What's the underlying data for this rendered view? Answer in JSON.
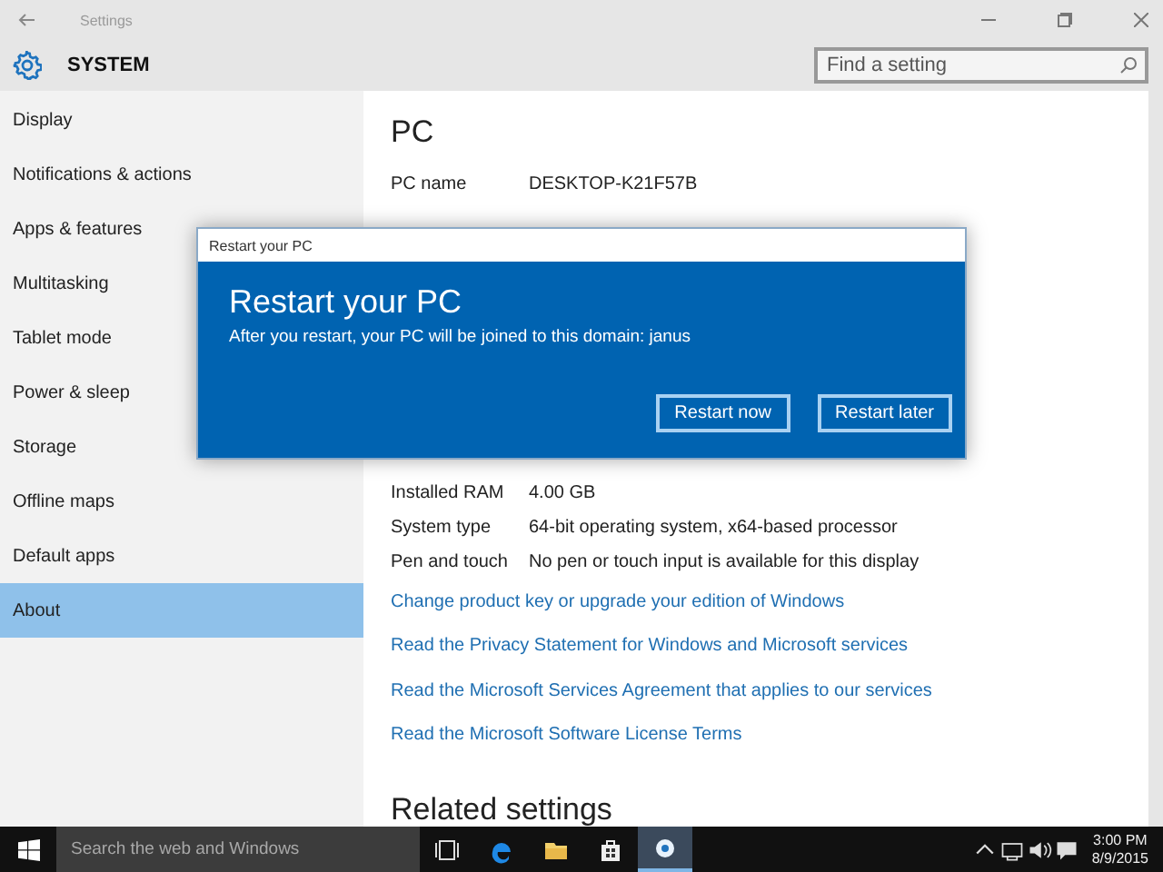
{
  "window": {
    "title": "Settings"
  },
  "header": {
    "title": "SYSTEM",
    "search": {
      "placeholder": "Find a setting"
    }
  },
  "sidebar": {
    "items": [
      {
        "label": "Display",
        "selected": false
      },
      {
        "label": "Notifications & actions",
        "selected": false
      },
      {
        "label": "Apps & features",
        "selected": false
      },
      {
        "label": "Multitasking",
        "selected": false
      },
      {
        "label": "Tablet mode",
        "selected": false
      },
      {
        "label": "Power & sleep",
        "selected": false
      },
      {
        "label": "Storage",
        "selected": false
      },
      {
        "label": "Offline maps",
        "selected": false
      },
      {
        "label": "Default apps",
        "selected": false
      },
      {
        "label": "About",
        "selected": true
      }
    ]
  },
  "content": {
    "heading": "PC",
    "identity": [
      {
        "label": "PC name",
        "value": "DESKTOP-K21F57B"
      }
    ],
    "specs": [
      {
        "label": "Installed RAM",
        "value": "4.00 GB"
      },
      {
        "label": "System type",
        "value": "64-bit operating system, x64-based processor"
      },
      {
        "label": "Pen and touch",
        "value": "No pen or touch input is available for this display"
      }
    ],
    "links": [
      "Change product key or upgrade your edition of Windows",
      "Read the Privacy Statement for Windows and Microsoft services",
      "Read the Microsoft Services Agreement that applies to our services",
      "Read the Microsoft Software License Terms"
    ],
    "section_heading": "Related settings"
  },
  "dialog": {
    "title": "Restart your PC",
    "heading": "Restart your PC",
    "message": "After you restart, your PC will be joined to this domain: janus",
    "buttons": [
      "Restart now",
      "Restart later"
    ]
  },
  "taskbar": {
    "search": {
      "placeholder": "Search the web and Windows"
    },
    "apps": [
      {
        "kind": "task-view",
        "selected": false
      },
      {
        "kind": "edge",
        "selected": false
      },
      {
        "kind": "explorer",
        "selected": false
      },
      {
        "kind": "store",
        "selected": false
      },
      {
        "kind": "settings",
        "selected": true
      }
    ],
    "time": "3:00 PM",
    "date": "8/9/2015"
  }
}
